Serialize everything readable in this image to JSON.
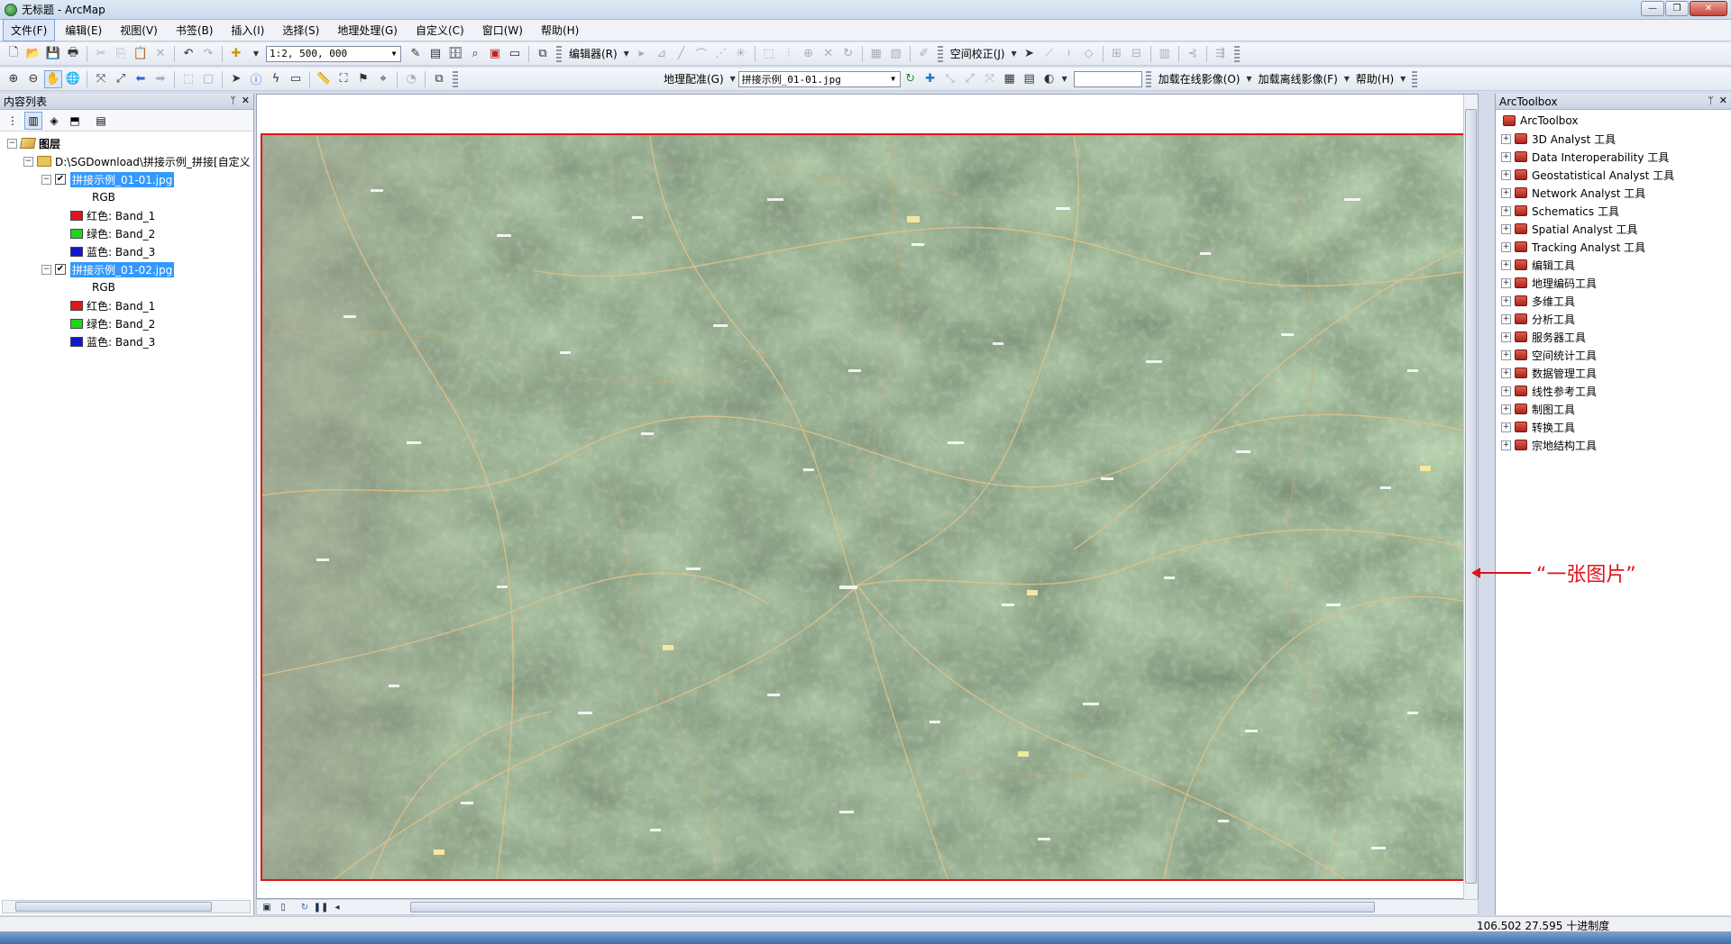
{
  "window": {
    "title": "无标题 - ArcMap",
    "controls": [
      "—",
      "❐",
      "✕"
    ]
  },
  "menubar": {
    "items": [
      "文件(F)",
      "编辑(E)",
      "视图(V)",
      "书签(B)",
      "插入(I)",
      "选择(S)",
      "地理处理(G)",
      "自定义(C)",
      "窗口(W)",
      "帮助(H)"
    ],
    "active_index": 0
  },
  "toolbar1": {
    "scale": "1:2, 500, 000",
    "editor_label": "编辑器(R)",
    "spatial_adjust_label": "空间校正(J)"
  },
  "toolbar2": {
    "georef_label": "地理配准(G)",
    "layer_combo": "拼接示例_01-01.jpg",
    "input_value": "",
    "online_imagery_label": "加载在线影像(O)",
    "offline_imagery_label": "加载离线影像(F)",
    "help_label": "帮助(H)"
  },
  "toc": {
    "header": "内容列表",
    "root_label": "图层",
    "folder_label": "D:\\SGDownload\\拼接示例_拼接[自定义",
    "layers": [
      {
        "name": "拼接示例_01-01.jpg",
        "rgb_label": "RGB",
        "bands": [
          {
            "label": "红色:    Band_1",
            "color": "#e0141a"
          },
          {
            "label": "绿色: Band_2",
            "color": "#1ed61e"
          },
          {
            "label": "蓝色:    Band_3",
            "color": "#1414d6"
          }
        ]
      },
      {
        "name": "拼接示例_01-02.jpg",
        "rgb_label": "RGB",
        "bands": [
          {
            "label": "红色:    Band_1",
            "color": "#e0141a"
          },
          {
            "label": "绿色: Band_2",
            "color": "#1ed61e"
          },
          {
            "label": "蓝色:    Band_3",
            "color": "#1414d6"
          }
        ]
      }
    ]
  },
  "annotation": {
    "text": "“一张图片”",
    "color": "#e0141a"
  },
  "toolbox": {
    "header": "ArcToolbox",
    "root_label": "ArcToolbox",
    "items": [
      "3D Analyst 工具",
      "Data Interoperability 工具",
      "Geostatistical Analyst 工具",
      "Network Analyst 工具",
      "Schematics 工具",
      "Spatial Analyst 工具",
      "Tracking Analyst 工具",
      "编辑工具",
      "地理编码工具",
      "多维工具",
      "分析工具",
      "服务器工具",
      "空间统计工具",
      "数据管理工具",
      "线性参考工具",
      "制图工具",
      "转换工具",
      "宗地结构工具"
    ]
  },
  "statusbar": {
    "coords": "106.502  27.595 十进制度"
  }
}
